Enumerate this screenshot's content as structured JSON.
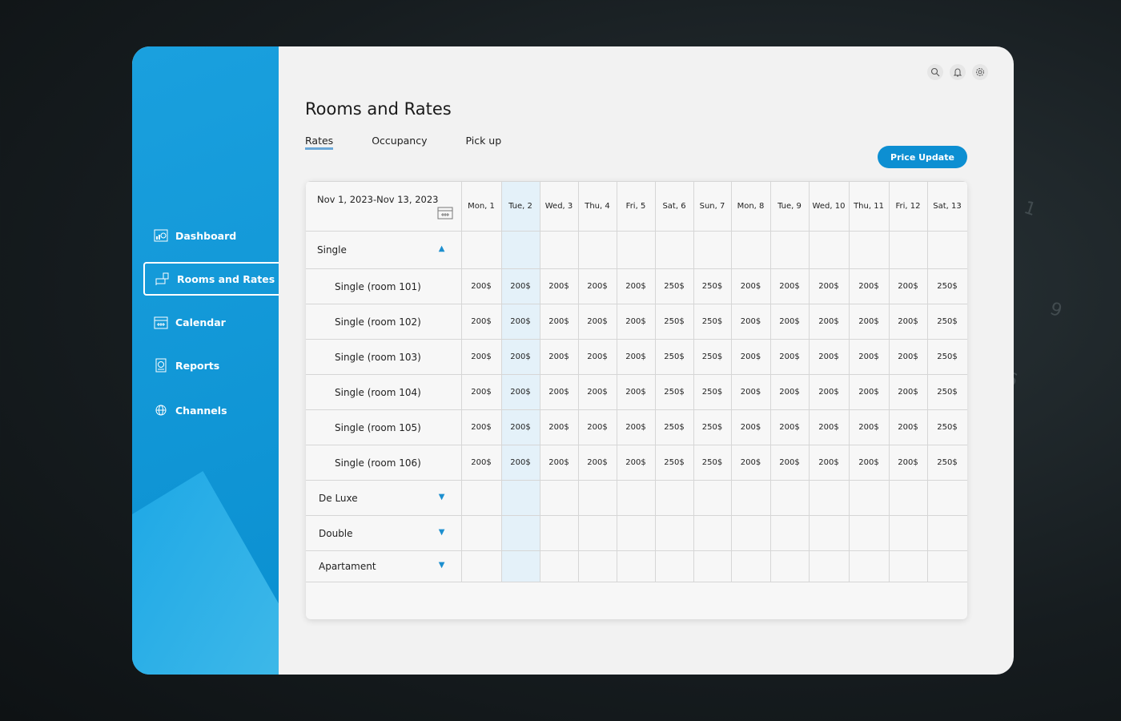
{
  "sidebar": {
    "items": [
      {
        "label": "Dashboard",
        "icon": "dashboard-icon"
      },
      {
        "label": "Rooms and Rates",
        "icon": "rooms-icon",
        "active": true
      },
      {
        "label": "Calendar",
        "icon": "calendar-icon"
      },
      {
        "label": "Reports",
        "icon": "reports-icon"
      },
      {
        "label": "Channels",
        "icon": "channels-icon"
      }
    ]
  },
  "header": {
    "title": "Rooms and Rates",
    "tabs": [
      {
        "label": "Rates",
        "active": true
      },
      {
        "label": "Occupancy"
      },
      {
        "label": "Pick up"
      }
    ],
    "price_update": "Price Update"
  },
  "colors": {
    "accent": "#0d8fd2",
    "highlight_column": "#e4f1f9"
  },
  "table": {
    "date_range": "Nov 1, 2023-Nov 13, 2023",
    "days": [
      "Mon, 1",
      "Tue, 2",
      "Wed, 3",
      "Thu, 4",
      "Fri, 5",
      "Sat, 6",
      "Sun, 7",
      "Mon, 8",
      "Tue, 9",
      "Wed, 10",
      "Thu, 11",
      "Fri, 12",
      "Sat, 13"
    ],
    "highlighted_day": "Tue, 2",
    "groups": [
      {
        "name": "Single",
        "expanded": true,
        "rooms": [
          {
            "name": "Single (room 101)",
            "rates": [
              "200$",
              "200$",
              "200$",
              "200$",
              "200$",
              "250$",
              "250$",
              "200$",
              "200$",
              "200$",
              "200$",
              "200$",
              "250$"
            ]
          },
          {
            "name": "Single (room 102)",
            "rates": [
              "200$",
              "200$",
              "200$",
              "200$",
              "200$",
              "250$",
              "250$",
              "200$",
              "200$",
              "200$",
              "200$",
              "200$",
              "250$"
            ]
          },
          {
            "name": "Single (room 103)",
            "rates": [
              "200$",
              "200$",
              "200$",
              "200$",
              "200$",
              "250$",
              "250$",
              "200$",
              "200$",
              "200$",
              "200$",
              "200$",
              "250$"
            ]
          },
          {
            "name": "Single (room 104)",
            "rates": [
              "200$",
              "200$",
              "200$",
              "200$",
              "200$",
              "250$",
              "250$",
              "200$",
              "200$",
              "200$",
              "200$",
              "200$",
              "250$"
            ]
          },
          {
            "name": "Single (room 105)",
            "rates": [
              "200$",
              "200$",
              "200$",
              "200$",
              "200$",
              "250$",
              "250$",
              "200$",
              "200$",
              "200$",
              "200$",
              "200$",
              "250$"
            ]
          },
          {
            "name": "Single (room 106)",
            "rates": [
              "200$",
              "200$",
              "200$",
              "200$",
              "200$",
              "250$",
              "250$",
              "200$",
              "200$",
              "200$",
              "200$",
              "200$",
              "250$"
            ]
          }
        ]
      },
      {
        "name": "De Luxe",
        "expanded": false,
        "rooms": []
      },
      {
        "name": "Double",
        "expanded": false,
        "rooms": []
      },
      {
        "name": "Apartament",
        "expanded": false,
        "rooms": []
      }
    ]
  }
}
